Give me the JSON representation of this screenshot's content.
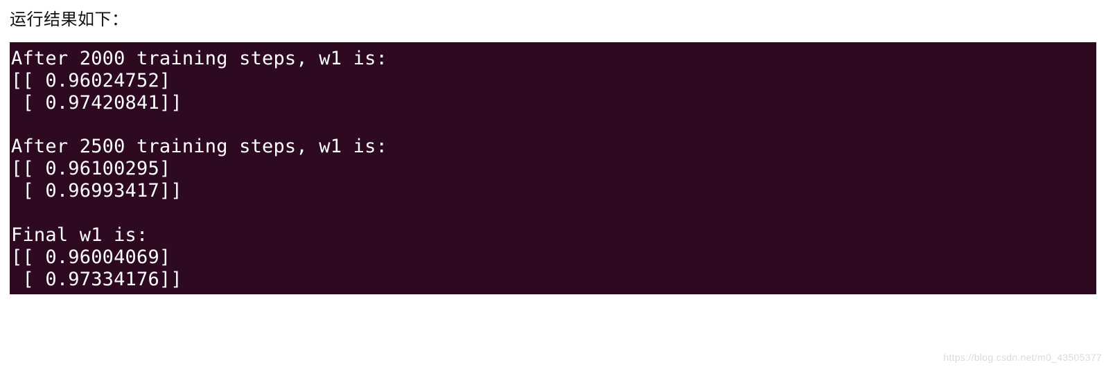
{
  "heading": "运行结果如下：",
  "terminal": {
    "lines": [
      "After 2000 training steps, w1 is:",
      "[[ 0.96024752]",
      " [ 0.97420841]]",
      "",
      "After 2500 training steps, w1 is:",
      "[[ 0.96100295]",
      " [ 0.96993417]]",
      "",
      "Final w1 is:",
      "[[ 0.96004069]",
      " [ 0.97334176]]"
    ]
  },
  "watermark": "https://blog.csdn.net/m0_43505377"
}
